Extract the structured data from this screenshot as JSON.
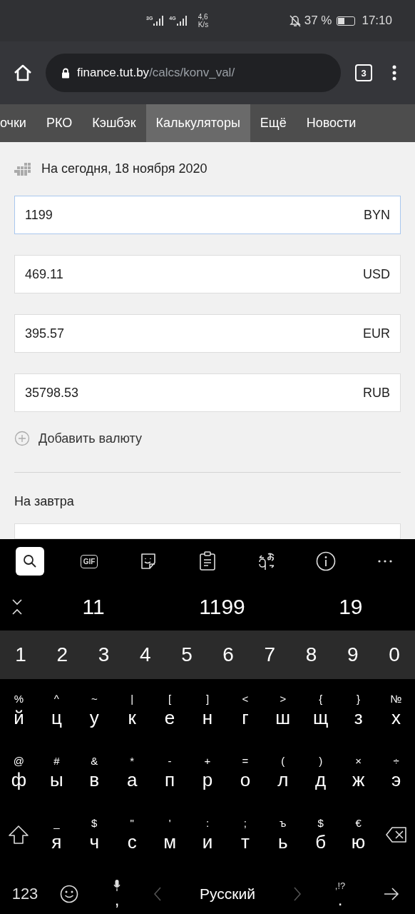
{
  "status_bar": {
    "networks": [
      {
        "label": "3G"
      },
      {
        "label": "4G"
      }
    ],
    "speed": [
      "4,6",
      "K/s"
    ],
    "battery": "37 %",
    "time": "17:10"
  },
  "browser": {
    "url_host": "finance.tut.by",
    "url_path": "/calcs/konv_val/",
    "tab_count": "3"
  },
  "nav_tabs": [
    {
      "label": "очки",
      "selected": false
    },
    {
      "label": "РКО",
      "selected": false
    },
    {
      "label": "Кэшбэк",
      "selected": false
    },
    {
      "label": "Калькуляторы",
      "selected": true
    },
    {
      "label": "Ещё",
      "selected": false
    },
    {
      "label": "Новости",
      "selected": false
    }
  ],
  "today_label": "На сегодня, 18 ноября 2020",
  "fields": [
    {
      "value": "1199",
      "currency": "BYN",
      "focused": true
    },
    {
      "value": "469.11",
      "currency": "USD",
      "focused": false
    },
    {
      "value": "395.57",
      "currency": "EUR",
      "focused": false
    },
    {
      "value": "35798.53",
      "currency": "RUB",
      "focused": false
    }
  ],
  "add_currency": "Добавить валюту",
  "tomorrow_label": "На завтра",
  "keyboard": {
    "tools": [
      {
        "kind": "search",
        "selected": true
      },
      {
        "kind": "gif",
        "label": "GIF",
        "selected": false
      },
      {
        "kind": "sticker",
        "selected": false
      },
      {
        "kind": "clipboard",
        "selected": false
      },
      {
        "kind": "translate",
        "selected": false
      },
      {
        "kind": "info",
        "selected": false
      },
      {
        "kind": "more",
        "selected": false
      }
    ],
    "suggestions": [
      "11",
      "1199",
      "19"
    ],
    "digits": [
      "1",
      "2",
      "3",
      "4",
      "5",
      "6",
      "7",
      "8",
      "9",
      "0"
    ],
    "rows": [
      [
        {
          "hint": "%",
          "label": "й"
        },
        {
          "hint": "^",
          "label": "ц"
        },
        {
          "hint": "~",
          "label": "у"
        },
        {
          "hint": "|",
          "label": "к"
        },
        {
          "hint": "[",
          "label": "е"
        },
        {
          "hint": "]",
          "label": "н"
        },
        {
          "hint": "<",
          "label": "г"
        },
        {
          "hint": ">",
          "label": "ш"
        },
        {
          "hint": "{",
          "label": "щ"
        },
        {
          "hint": "}",
          "label": "з"
        },
        {
          "hint": "№",
          "label": "х"
        }
      ],
      [
        {
          "hint": "@",
          "label": "ф"
        },
        {
          "hint": "#",
          "label": "ы"
        },
        {
          "hint": "&",
          "label": "в"
        },
        {
          "hint": "*",
          "label": "а"
        },
        {
          "hint": "-",
          "label": "п"
        },
        {
          "hint": "+",
          "label": "р"
        },
        {
          "hint": "=",
          "label": "о"
        },
        {
          "hint": "(",
          "label": "л"
        },
        {
          "hint": ")",
          "label": "д"
        },
        {
          "hint": "×",
          "label": "ж"
        },
        {
          "hint": "÷",
          "label": "э"
        }
      ],
      [
        {
          "kind": "shift"
        },
        {
          "hint": "_",
          "label": "я"
        },
        {
          "hint": "$",
          "label": "ч"
        },
        {
          "hint": "\"",
          "label": "с"
        },
        {
          "hint": "'",
          "label": "м"
        },
        {
          "hint": ":",
          "label": "и"
        },
        {
          "hint": ";",
          "label": "т"
        },
        {
          "hint": "ъ",
          "label": "ь"
        },
        {
          "hint": "$",
          "label": "б"
        },
        {
          "hint": "€",
          "label": "ю"
        },
        {
          "kind": "backspace"
        }
      ]
    ],
    "bottom": {
      "symbols": "123",
      "comma": ",",
      "space": "Русский",
      "period_hint": ",!?",
      "period": "."
    }
  }
}
